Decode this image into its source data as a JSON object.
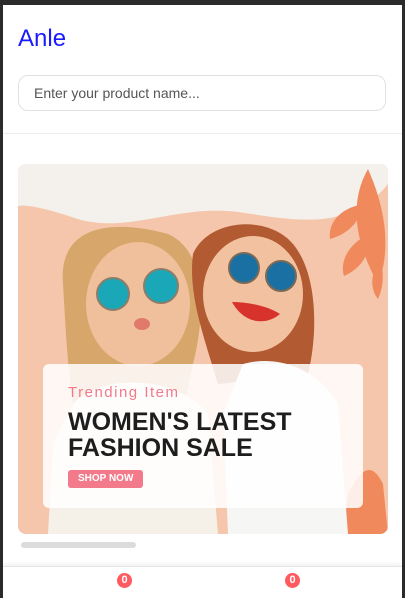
{
  "header": {
    "brand": "Anle",
    "search_placeholder": "Enter your product name..."
  },
  "banner": {
    "eyebrow": "Trending Item",
    "title": "WOMEN'S LATEST FASHION SALE",
    "cta_label": "SHOP NOW",
    "accent_color": "#f27a8a"
  },
  "bottom_nav": {
    "items": [
      {
        "badge": "0"
      },
      {
        "badge": "0"
      }
    ]
  }
}
